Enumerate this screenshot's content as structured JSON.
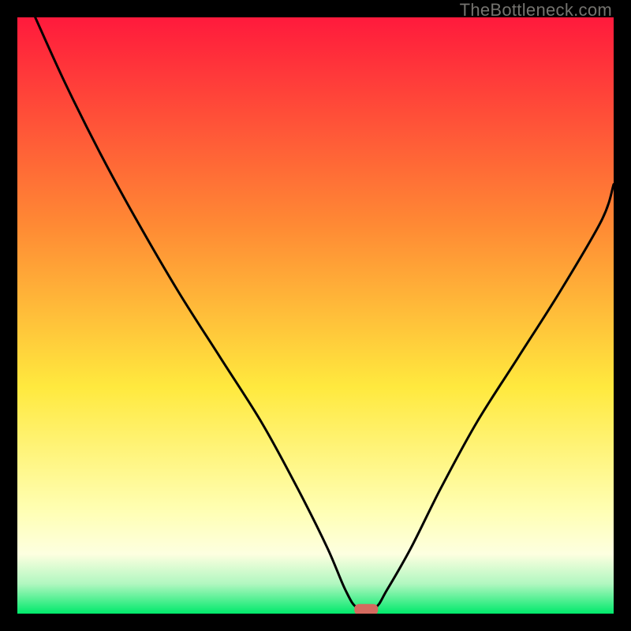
{
  "watermark": "TheBottleneck.com",
  "colors": {
    "red_top": "#ff1a3c",
    "orange": "#ff8a34",
    "yellow": "#ffe93e",
    "pale_yellow": "#ffffb5",
    "cream": "#fdffe0",
    "mint": "#b1f7c0",
    "green_bottom": "#00e96b",
    "curve": "#000000",
    "marker": "#d46a5f",
    "frame_bg": "#000000"
  },
  "chart_data": {
    "type": "line",
    "title": "",
    "xlabel": "",
    "ylabel": "",
    "xlim": [
      0,
      100
    ],
    "ylim": [
      0,
      100
    ],
    "series": [
      {
        "name": "bottleneck-curve",
        "x": [
          3,
          8,
          14,
          20,
          27,
          34,
          41,
          47,
          52,
          55,
          57,
          60,
          62,
          66,
          71,
          77,
          84,
          91,
          98,
          100
        ],
        "y": [
          100,
          89,
          77,
          66,
          54,
          43,
          32,
          21,
          11,
          4,
          1,
          1,
          4,
          11,
          21,
          32,
          43,
          54,
          66,
          72
        ]
      }
    ],
    "marker": {
      "x": 58.5,
      "y": 0.7
    },
    "gradient_stops": [
      {
        "pos": 0,
        "color": "#ff1a3c"
      },
      {
        "pos": 35,
        "color": "#ff8a34"
      },
      {
        "pos": 62,
        "color": "#ffe93e"
      },
      {
        "pos": 83,
        "color": "#ffffb5"
      },
      {
        "pos": 90,
        "color": "#fdffe0"
      },
      {
        "pos": 95,
        "color": "#b1f7c0"
      },
      {
        "pos": 100,
        "color": "#00e96b"
      }
    ]
  }
}
